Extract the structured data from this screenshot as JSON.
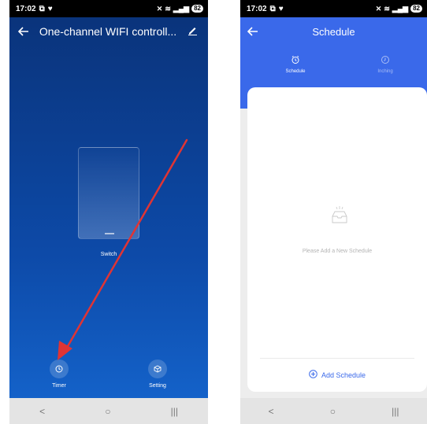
{
  "status_bar": {
    "time": "17:02",
    "battery": "82"
  },
  "left": {
    "header": {
      "title": "One-channel WIFI controll..."
    },
    "device": {
      "label": "Switch"
    },
    "bottom": {
      "timer_label": "Timer",
      "setting_label": "Setting"
    }
  },
  "right": {
    "header": {
      "title": "Schedule"
    },
    "tabs": [
      {
        "label": "Schedule",
        "active": true
      },
      {
        "label": "Inching",
        "active": false
      }
    ],
    "empty_message": "Please Add a New Schedule",
    "add_button_label": "Add Schedule"
  },
  "nav": {
    "back": "<",
    "home": "○",
    "recents": "|||"
  },
  "colors": {
    "accent": "#3a69ea",
    "annotation_arrow": "#e03434"
  }
}
